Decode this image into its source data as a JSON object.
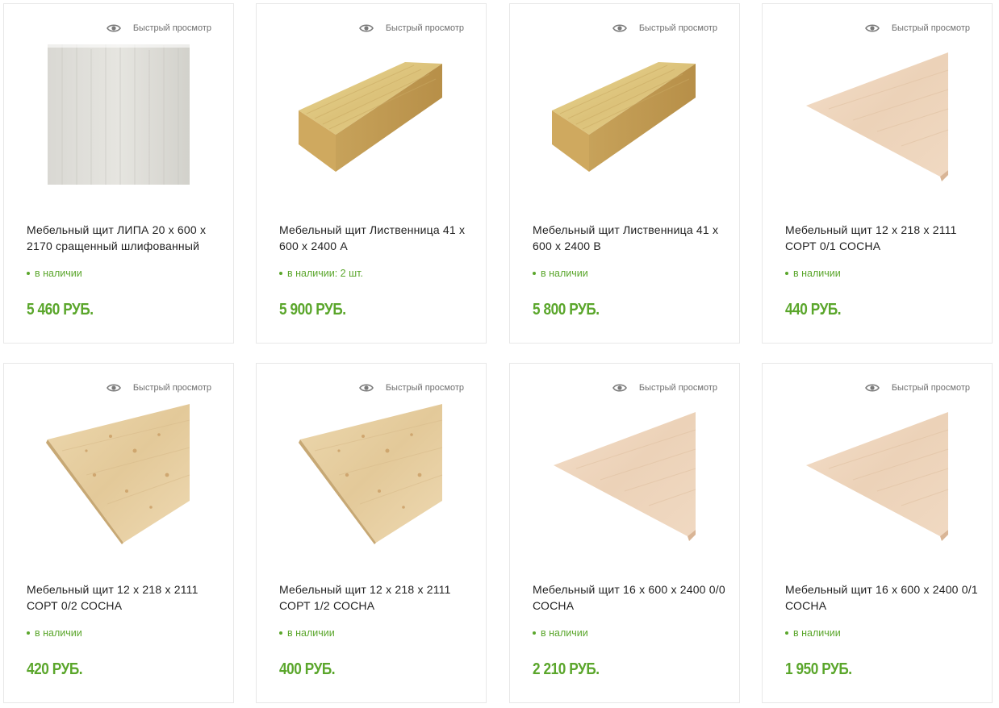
{
  "quick_view_label": "Быстрый просмотр",
  "products": [
    {
      "title": "Мебельный щит ЛИПА 20 х 600 х 2170 сращенный шлифованный",
      "stock": "в наличии",
      "price": "5 460 РУБ.",
      "image_kind": "linden-panel"
    },
    {
      "title": "Мебельный щит Лиственница 41 х 600 х 2400 А",
      "stock": "в наличии: 2 шт.",
      "price": "5 900 РУБ.",
      "image_kind": "larch-panel"
    },
    {
      "title": "Мебельный щит Лиственница 41 х 600 х 2400 В",
      "stock": "в наличии",
      "price": "5 800 РУБ.",
      "image_kind": "larch-panel"
    },
    {
      "title": "Мебельный щит 12 х 218 х 2111 СОРТ 0/1 СОСНА",
      "stock": "в наличии",
      "price": "440 РУБ.",
      "image_kind": "pine-panel-light"
    },
    {
      "title": "Мебельный щит 12 х 218 х 2111 СОРТ 0/2 СОСНА",
      "stock": "в наличии",
      "price": "420 РУБ.",
      "image_kind": "pine-panel-knotty"
    },
    {
      "title": "Мебельный щит 12 х 218 х 2111 СОРТ 1/2 СОСНА",
      "stock": "в наличии",
      "price": "400 РУБ.",
      "image_kind": "pine-panel-knotty"
    },
    {
      "title": "Мебельный щит 16 х 600 х 2400 0/0 СОСНА",
      "stock": "в наличии",
      "price": "2 210 РУБ.",
      "image_kind": "pine-panel-light"
    },
    {
      "title": "Мебельный щит 16 х 600 х 2400 0/1 СОСНА",
      "stock": "в наличии",
      "price": "1 950 РУБ.",
      "image_kind": "pine-panel-light"
    }
  ],
  "colors": {
    "accent_green": "#5aa62b",
    "text": "#1f1f1f",
    "muted": "#6f6f6f",
    "border": "#e8e8e8"
  }
}
